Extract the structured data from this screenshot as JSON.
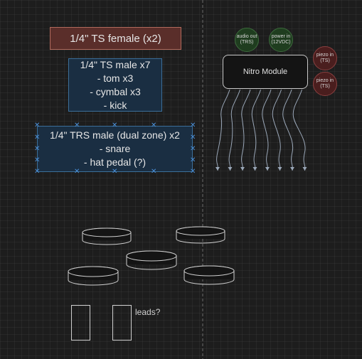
{
  "connectors": {
    "ts_female": "1/4\" TS female (x2)",
    "ts_male": [
      "1/4\" TS male x7",
      "- tom x3",
      "- cymbal x3",
      "- kick"
    ],
    "trs_male": [
      "1/4\" TRS male  (dual zone) x2",
      "- snare",
      "- hat pedal (?)"
    ]
  },
  "module": {
    "label": "Nitro Module",
    "ports": [
      {
        "lines": [
          "audio out",
          "(TRS)"
        ],
        "color": "#1f3d1f"
      },
      {
        "lines": [
          "power in",
          "(12VDC)"
        ],
        "color": "#1f3d1f"
      },
      {
        "lines": [
          "piezo in",
          "(TS)"
        ],
        "color": "#4a1e1e"
      },
      {
        "lines": [
          "piezo in",
          "(TS)"
        ],
        "color": "#4a1e1e"
      }
    ],
    "cable_count": 8
  },
  "kit": {
    "leads_label": "leads?"
  },
  "colors": {
    "grid_guide": "#6a6a6a",
    "cable": "#9aa7b8"
  }
}
